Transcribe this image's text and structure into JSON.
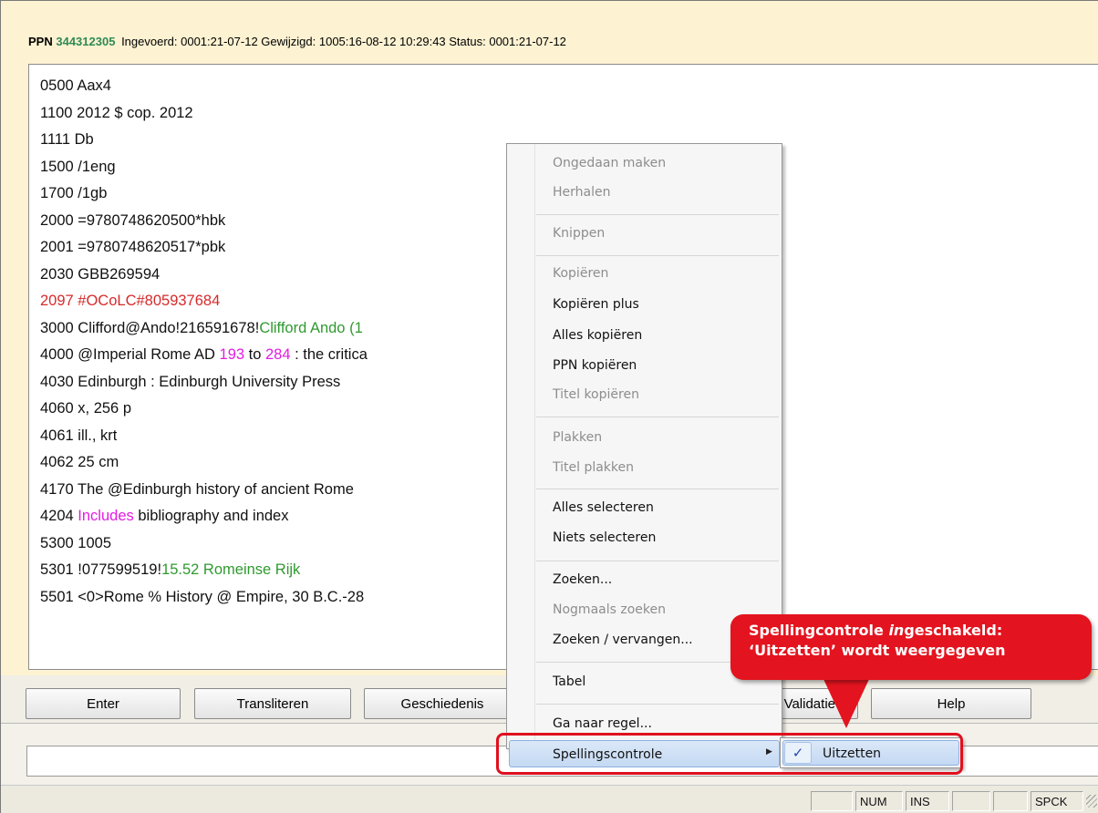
{
  "header": {
    "ppn_label": "PPN",
    "ppn_number": "344312305",
    "details": "Ingevoerd: 0001:21-07-12 Gewijzigd: 1005:16-08-12 10:29:43 Status: 0001:21-07-12"
  },
  "record_lines": [
    {
      "segments": [
        {
          "text": "0500 Aax4"
        }
      ]
    },
    {
      "segments": [
        {
          "text": "1100 2012 $ cop. 2012"
        }
      ]
    },
    {
      "segments": [
        {
          "text": "1111 Db"
        }
      ]
    },
    {
      "segments": [
        {
          "text": "1500 /1eng"
        }
      ]
    },
    {
      "segments": [
        {
          "text": "1700 /1gb"
        }
      ]
    },
    {
      "segments": [
        {
          "text": "2000 =9780748620500*hbk"
        }
      ]
    },
    {
      "segments": [
        {
          "text": "2001 =9780748620517*pbk"
        }
      ]
    },
    {
      "segments": [
        {
          "text": "2030 GBB269594"
        }
      ]
    },
    {
      "segments": [
        {
          "text": "2097 #OCoLC#805937684",
          "color": "red"
        }
      ]
    },
    {
      "segments": [
        {
          "text": "3000 Clifford@Ando!216591678!"
        },
        {
          "text": "Clifford Ando (1",
          "color": "green"
        }
      ]
    },
    {
      "segments": [
        {
          "text": "4000 @Imperial Rome AD "
        },
        {
          "text": "193",
          "color": "magenta"
        },
        {
          "text": " to "
        },
        {
          "text": "284",
          "color": "magenta"
        },
        {
          "text": " : the critica"
        }
      ]
    },
    {
      "segments": [
        {
          "text": "4030 Edinburgh : Edinburgh University Press"
        }
      ]
    },
    {
      "segments": [
        {
          "text": "4060 x, 256 p"
        }
      ]
    },
    {
      "segments": [
        {
          "text": "4061 ill., krt"
        }
      ]
    },
    {
      "segments": [
        {
          "text": "4062 25 cm"
        }
      ]
    },
    {
      "segments": [
        {
          "text": "4170 The @Edinburgh history of ancient Rome"
        }
      ]
    },
    {
      "segments": [
        {
          "text": "4204 "
        },
        {
          "text": "Includes",
          "color": "magenta"
        },
        {
          "text": " bibliography and index"
        }
      ]
    },
    {
      "segments": [
        {
          "text": "5300 1005"
        }
      ]
    },
    {
      "segments": [
        {
          "text": "5301 !077599519!"
        },
        {
          "text": "15.52 Romeinse Rijk",
          "color": "green"
        }
      ]
    },
    {
      "segments": [
        {
          "text": "5501 <0>Rome % History @ Empire, 30 B.C.-28"
        }
      ]
    }
  ],
  "buttons": {
    "enter": "Enter",
    "transliterate": "Transliteren",
    "history": "Geschiedenis",
    "validate": "Validatie",
    "help": "Help"
  },
  "command_input": {
    "value": ""
  },
  "statusbar": [
    "",
    "NUM",
    "INS",
    "",
    "",
    "SPCK"
  ],
  "context_menu": {
    "undo": "Ongedaan maken",
    "redo": "Herhalen",
    "cut": "Knippen",
    "copy": "Kopiëren",
    "copy_plus": "Kopiëren plus",
    "copy_all": "Alles kopiëren",
    "copy_ppn": "PPN kopiëren",
    "copy_title": "Titel kopiëren",
    "paste": "Plakken",
    "paste_title": "Titel plakken",
    "select_all": "Alles selecteren",
    "select_none": "Niets selecteren",
    "find": "Zoeken...",
    "find_again": "Nogmaals zoeken",
    "find_replace": "Zoeken / vervangen...",
    "table": "Tabel",
    "goto_line": "Ga naar regel...",
    "spellcheck": "Spellingscontrole"
  },
  "submenu": {
    "check": "✓",
    "turn_off": "Uitzetten"
  },
  "callout": {
    "line1_pre": "Spellingcontrole ",
    "line1_em": "in",
    "line1_post": "geschakeld:",
    "line2": "‘Uitzetten’ wordt weergegeven"
  },
  "colors": {
    "red": "#d62a2a",
    "green": "#2f9a2f",
    "magenta": "#e31ce3",
    "callout": "#e3141f",
    "menu_highlight": "#c4d9f3"
  }
}
